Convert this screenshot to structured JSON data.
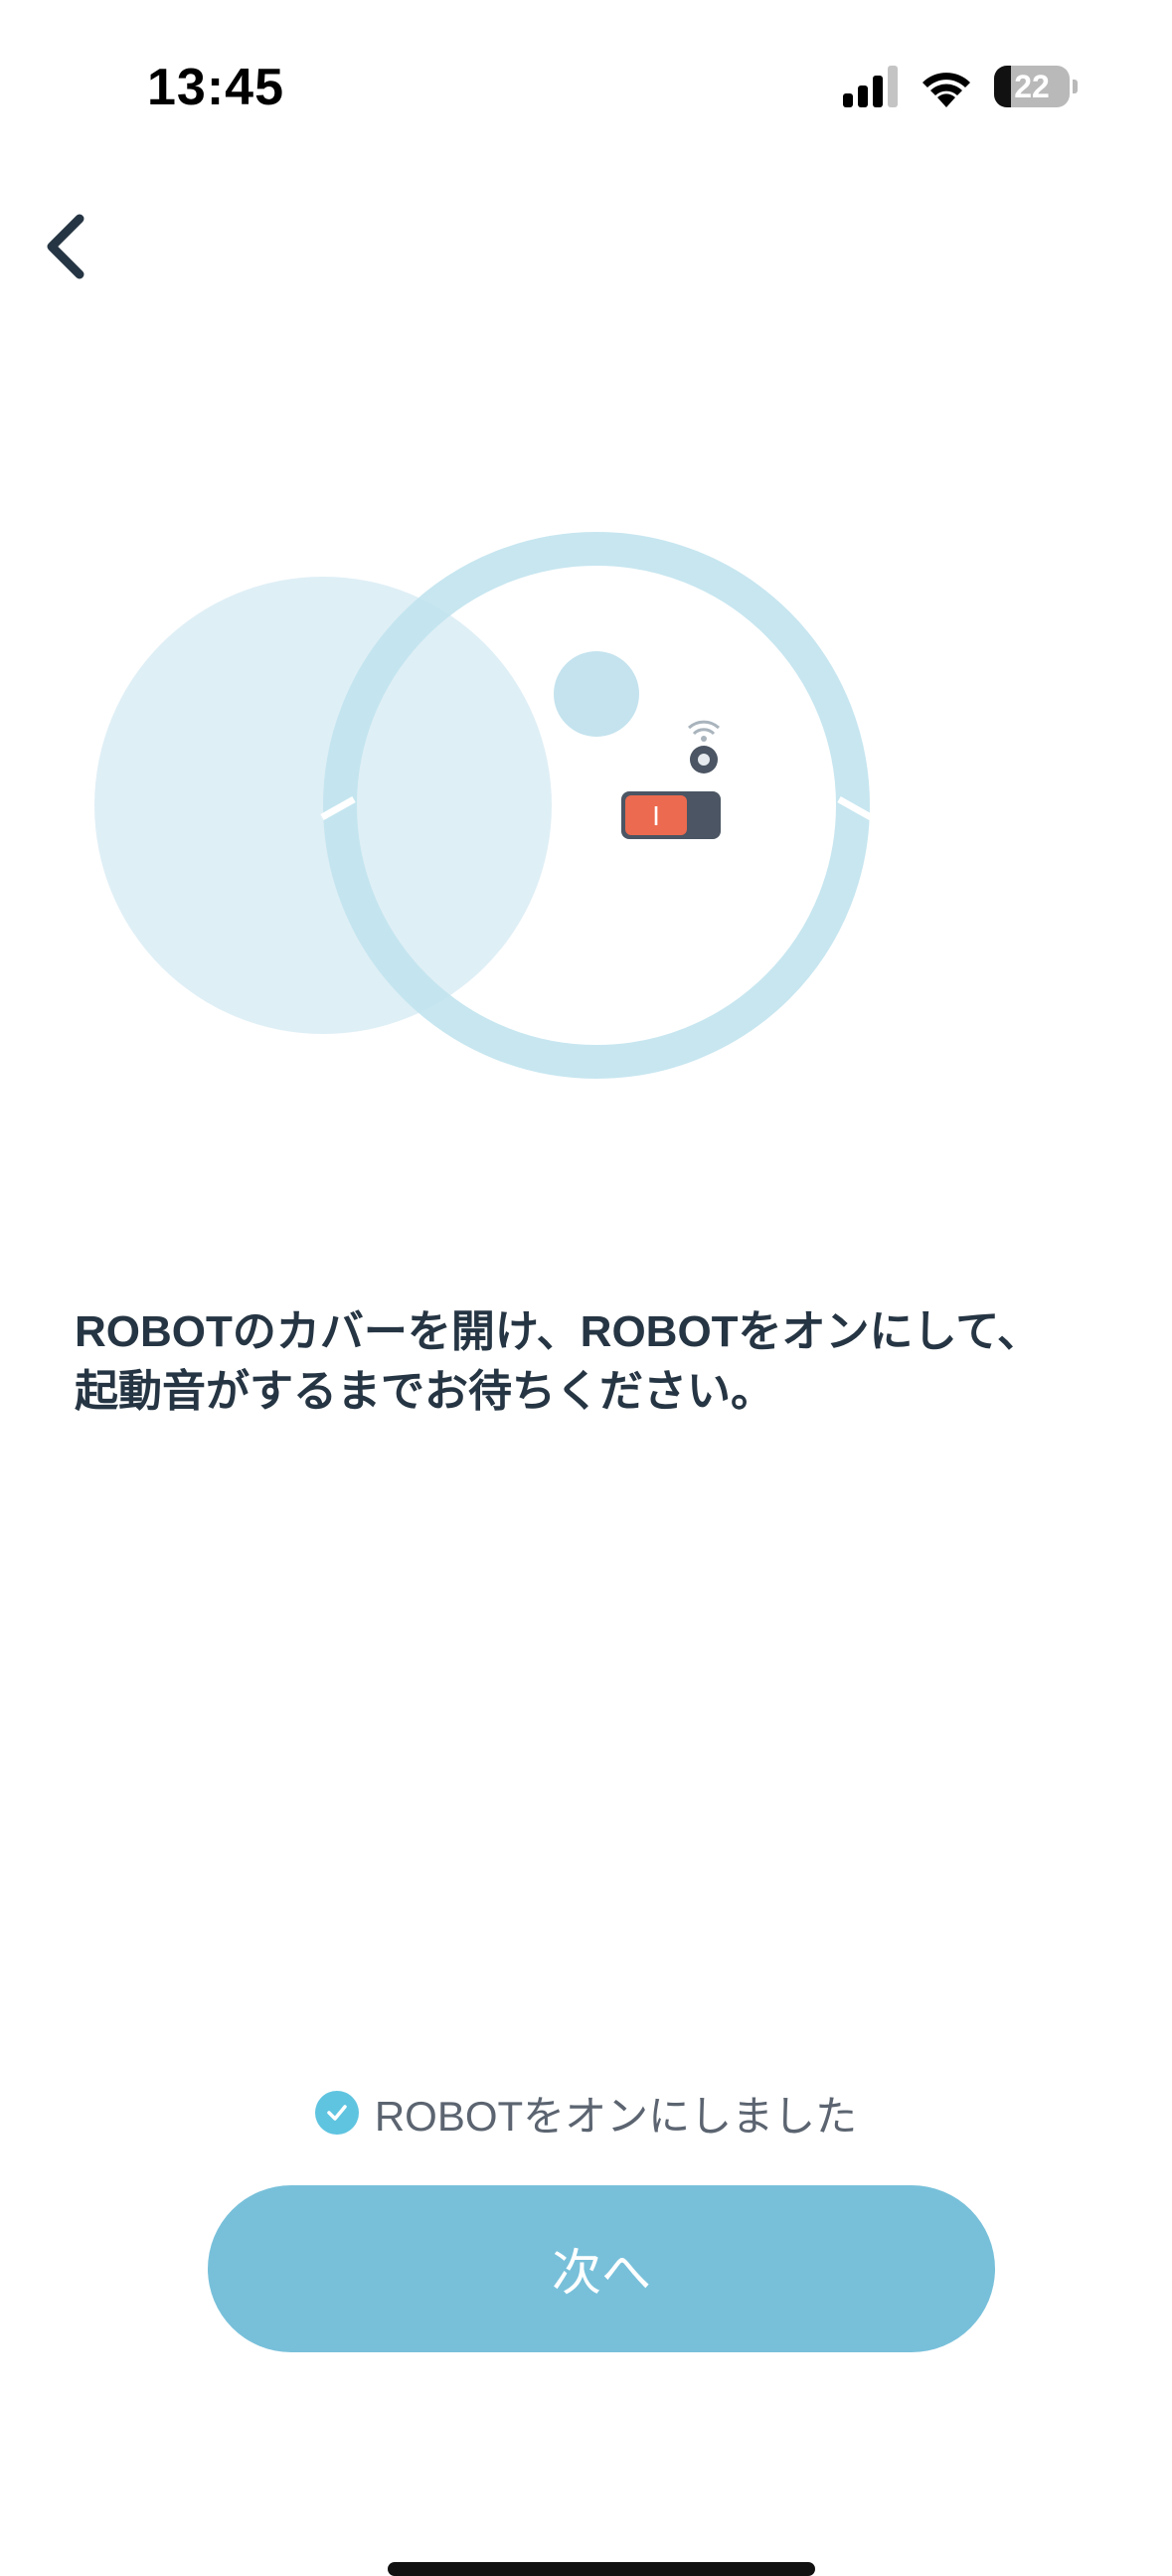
{
  "status_bar": {
    "time": "13:45",
    "battery_level": "22",
    "battery_fraction": 0.22,
    "icons": [
      "signal-icon",
      "wifi-icon",
      "battery-icon"
    ]
  },
  "nav": {
    "back_icon": "chevron-left-icon"
  },
  "illustration": {
    "switch_label": "I",
    "colors": {
      "ring": "#c8e6f0",
      "cover": "#ddeef5",
      "button": "#c4e3ee",
      "switch_on": "#ec6a4f",
      "switch_body": "#4b5563"
    }
  },
  "instruction": {
    "text": "ROBOTのカバーを開け、ROBOTをオンにして、起動音がするまでお待ちください。"
  },
  "confirm": {
    "checked": true,
    "label": "ROBOTをオンにしました",
    "check_icon": "check-circle-icon"
  },
  "next_button": {
    "label": "次へ"
  },
  "colors": {
    "accent": "#78c0da",
    "check": "#5fc4e0",
    "text": "#263543"
  }
}
